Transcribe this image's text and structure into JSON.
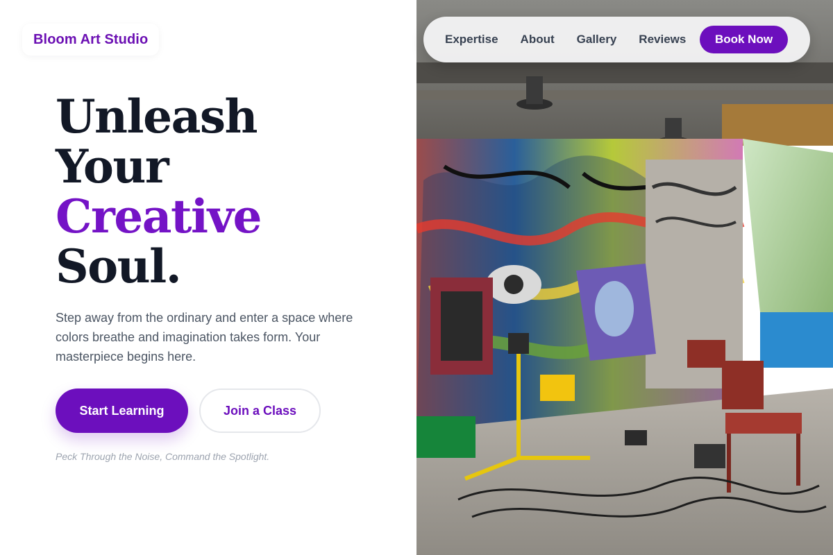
{
  "brand": {
    "name": "Bloom Art Studio",
    "color": "#6b0fb3"
  },
  "nav": {
    "links": [
      "Expertise",
      "About",
      "Gallery",
      "Reviews"
    ],
    "cta": "Book Now"
  },
  "hero": {
    "line1": "Unleash",
    "line2": "Your",
    "line3": "Creative",
    "line4": "Soul.",
    "subtitle": "Step away from the ordinary and enter a space where colors breathe and imagination takes form. Your masterpiece begins here.",
    "primary_cta": "Start Learning",
    "secondary_cta": "Join a Class",
    "tagline": "Peck Through the Noise, Command the Spotlight."
  },
  "colors": {
    "accent": "#7413c6",
    "primary_button": "#6c0fbd",
    "heading": "#121826",
    "body_text": "#4b5563"
  },
  "image": {
    "icon": "graffiti-art-studio-photo"
  }
}
